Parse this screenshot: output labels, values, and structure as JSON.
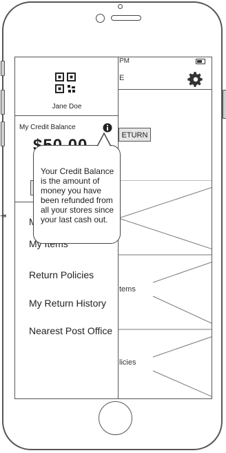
{
  "status_bar": {
    "time_fragment": "PM"
  },
  "app_header": {
    "title_fragment": "E"
  },
  "main": {
    "return_button_label": "ETURN",
    "panel_labels": [
      "tems",
      "licies"
    ]
  },
  "drawer": {
    "user_name": "Jane Doe",
    "credit_label": "My Credit Balance",
    "balance_fragment": "$50.00",
    "menu_items": [
      "My Items",
      "Return Policies",
      "My Return History",
      "Nearest Post Office"
    ],
    "menu_item_partial": "M"
  },
  "tooltip": {
    "text": "Your Credit Balance is the amount of money you have been refunded from all your stores since your last cash out."
  },
  "icons": {
    "qr": "qr-code-icon",
    "info": "info-icon",
    "gear": "gear-icon",
    "battery": "battery-icon"
  }
}
